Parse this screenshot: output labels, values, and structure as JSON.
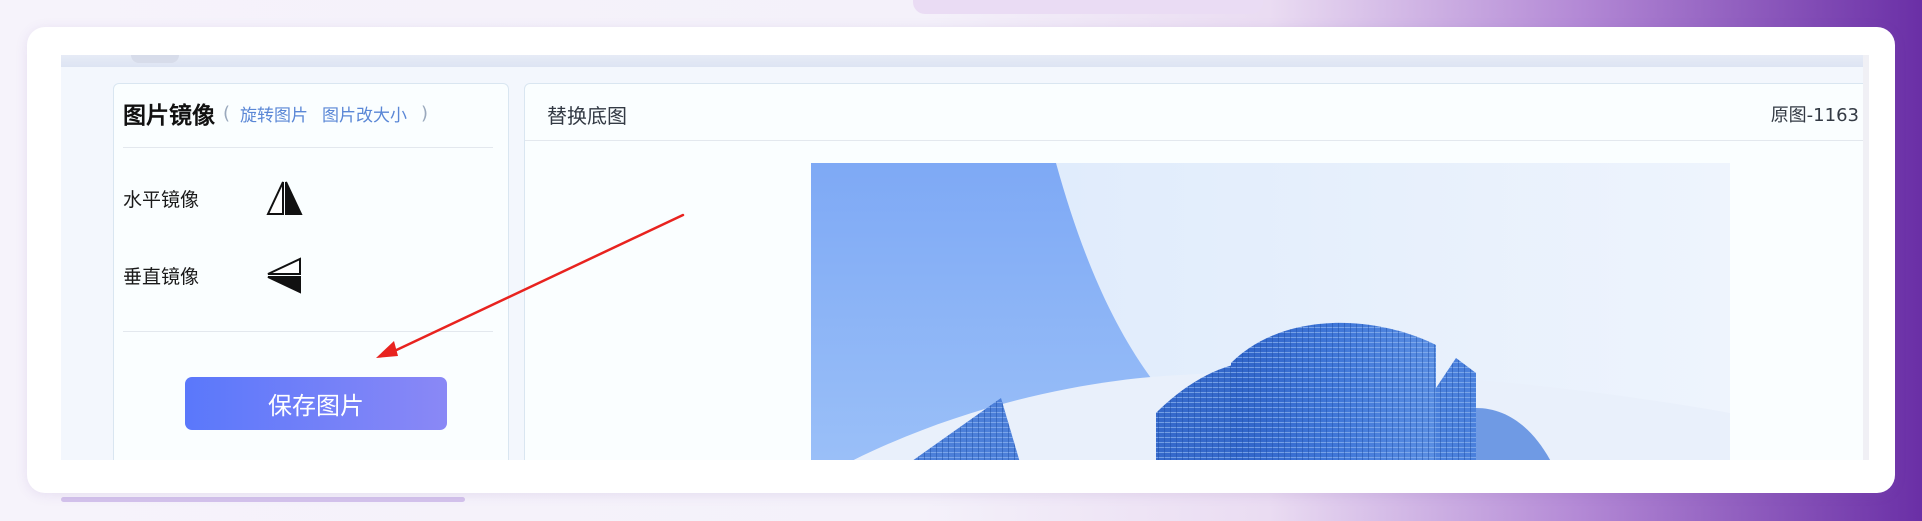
{
  "mirror_panel": {
    "title": "图片镜像",
    "open_paren": "(",
    "close_paren": ")",
    "links": [
      "旋转图片",
      "图片改大小"
    ],
    "horizontal_label": "水平镜像",
    "horizontal_icon": "horizontal-mirror-icon",
    "vertical_label": "垂直镜像",
    "vertical_icon": "vertical-mirror-icon",
    "save_label": "保存图片"
  },
  "preview_panel": {
    "replace_label": "替换底图",
    "original_size": "原图-1163"
  },
  "colors": {
    "save_gradient_start": "#5a78fb",
    "save_gradient_end": "#8a88f6",
    "link": "#5a87d6",
    "annotation_arrow": "#e8231f"
  }
}
